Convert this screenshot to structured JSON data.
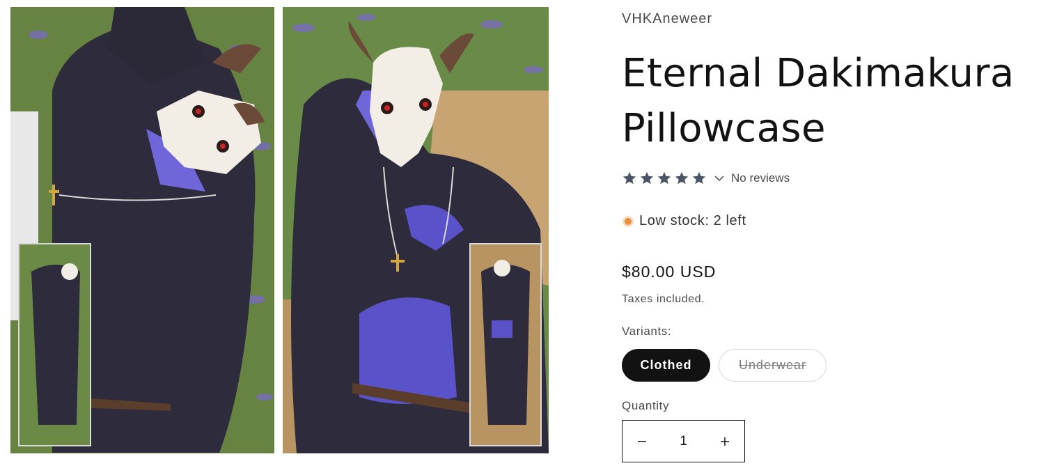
{
  "product": {
    "vendor": "VHKAneweer",
    "title": "Eternal Dakimakura Pillowcase",
    "rating": {
      "stars": 5,
      "reviews_text": "No reviews",
      "toggle_icon": "chevron-down-icon"
    },
    "stock": {
      "text": "Low stock: 2 left",
      "color": "#E8913A"
    },
    "price": "$80.00 USD",
    "tax_note": "Taxes included.",
    "variants": {
      "label": "Variants:",
      "options": [
        {
          "label": "Clothed",
          "selected": true,
          "available": true
        },
        {
          "label": "Underwear",
          "selected": false,
          "available": false
        }
      ]
    },
    "quantity": {
      "label": "Quantity",
      "value": "1",
      "minus_icon": "minus-icon",
      "plus_icon": "plus-icon"
    }
  },
  "gallery": {
    "images": [
      {
        "name": "product-image-side-a"
      },
      {
        "name": "product-image-side-b"
      }
    ]
  },
  "colors": {
    "accent": "#121212",
    "star": "#4A5568",
    "stock_dot": "#E8913A"
  }
}
